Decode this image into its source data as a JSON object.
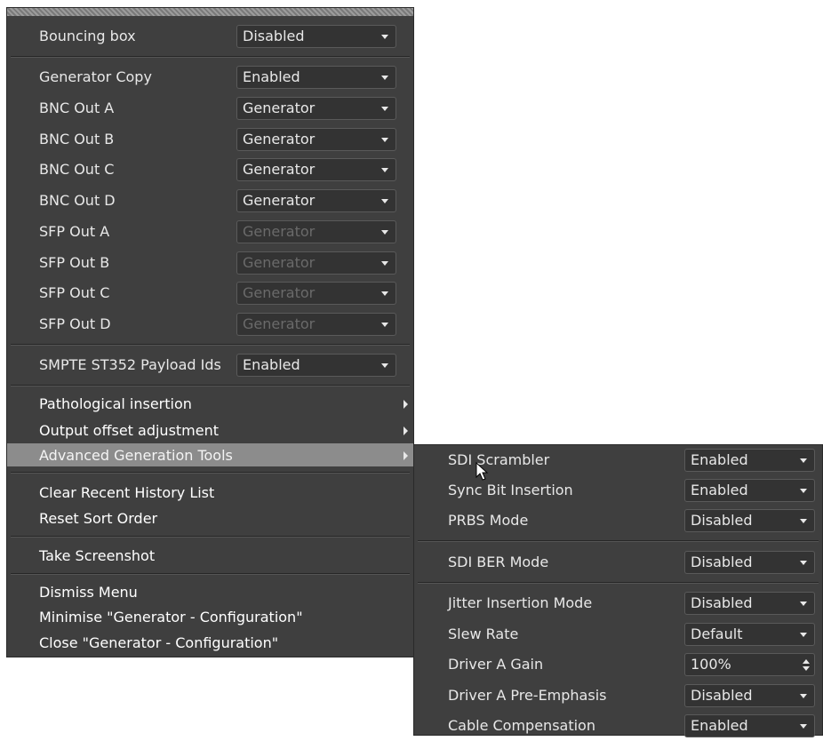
{
  "main_menu": {
    "bouncing_box": {
      "label": "Bouncing box",
      "value": "Disabled"
    },
    "generator_copy": {
      "label": "Generator Copy",
      "value": "Enabled"
    },
    "outputs": [
      {
        "label": "BNC Out A",
        "value": "Generator",
        "enabled": true
      },
      {
        "label": "BNC Out B",
        "value": "Generator",
        "enabled": true
      },
      {
        "label": "BNC Out C",
        "value": "Generator",
        "enabled": true
      },
      {
        "label": "BNC Out D",
        "value": "Generator",
        "enabled": true
      },
      {
        "label": "SFP Out A",
        "value": "Generator",
        "enabled": false
      },
      {
        "label": "SFP Out B",
        "value": "Generator",
        "enabled": false
      },
      {
        "label": "SFP Out C",
        "value": "Generator",
        "enabled": false
      },
      {
        "label": "SFP Out D",
        "value": "Generator",
        "enabled": false
      }
    ],
    "smpte": {
      "label": "SMPTE ST352 Payload Ids",
      "value": "Enabled"
    },
    "submenus": [
      {
        "label": "Pathological insertion"
      },
      {
        "label": "Output offset adjustment"
      },
      {
        "label": "Advanced Generation Tools"
      }
    ],
    "actions": {
      "clear_history": "Clear Recent History List",
      "reset_sort": "Reset Sort Order",
      "screenshot": "Take Screenshot",
      "dismiss": "Dismiss Menu",
      "minimise": "Minimise \"Generator - Configuration\"",
      "close": "Close \"Generator - Configuration\""
    }
  },
  "sub_menu": {
    "group1": [
      {
        "label": "SDI Scrambler",
        "value": "Enabled"
      },
      {
        "label": "Sync Bit Insertion",
        "value": "Enabled"
      },
      {
        "label": "PRBS Mode",
        "value": "Disabled"
      }
    ],
    "group2": [
      {
        "label": "SDI BER Mode",
        "value": "Disabled"
      }
    ],
    "group3": [
      {
        "label": "Jitter Insertion Mode",
        "value": "Disabled"
      },
      {
        "label": "Slew Rate",
        "value": "Default"
      },
      {
        "label": "Driver A Gain",
        "value": "100%"
      },
      {
        "label": "Driver A Pre-Emphasis",
        "value": "Disabled"
      },
      {
        "label": "Cable Compensation",
        "value": "Enabled"
      }
    ]
  },
  "colors": {
    "menu_bg": "#3f3f3f",
    "highlight": "#8c8c8c",
    "text": "#e8e8e8"
  },
  "icons": {
    "dropdown": "chevron-down-icon",
    "submenu": "chevron-right-icon",
    "spinner": "spinner-arrows-icon",
    "pointer": "mouse-pointer-icon"
  }
}
